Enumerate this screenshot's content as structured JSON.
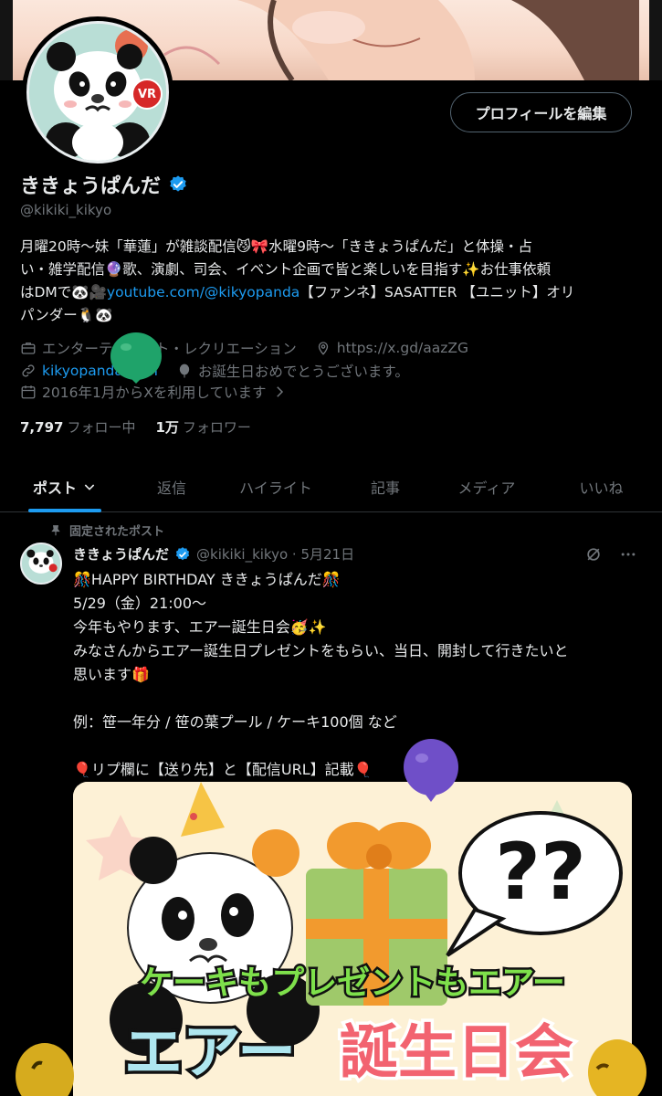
{
  "profile": {
    "display_name": "ききょうぱんだ",
    "handle": "@kikiki_kikyo",
    "edit_button": "プロフィールを編集",
    "avatar_badge": "VR",
    "bio": {
      "line1": "月曜20時〜妹「華蓮」が雑談配信😼🎀水曜9時〜「ききょうぱんだ」と体操・占",
      "line2": "い・雑学配信🔮歌、演劇、司会、イベント企画で皆と楽しいを目指す✨お仕事依頼",
      "line3_pre": "はDMで🐼🎥",
      "line3_link": "youtube.com/@kikyopanda",
      "line3_post": "【ファンネ】SASATTER 【ユニット】オリ",
      "line4": "パンダー🐧🐼"
    },
    "category": "エンターテイメント・レクリエーション",
    "location_link": "https://x.gd/aazZG",
    "website": "kikyopanda.com",
    "birthday": "お誕生日おめでとうございます。",
    "joined": "2016年1月からXを利用しています",
    "following_count": "7,797",
    "following_label": "フォロー中",
    "followers_count": "1万",
    "followers_label": "フォロワー"
  },
  "tabs": [
    {
      "label": "ポスト"
    },
    {
      "label": "返信"
    },
    {
      "label": "ハイライト"
    },
    {
      "label": "記事"
    },
    {
      "label": "メディア"
    },
    {
      "label": "いいね"
    }
  ],
  "post": {
    "pinned_label": "固定されたポスト",
    "author": "ききょうぱんだ",
    "handle_date": "@kikiki_kikyo · 5月21日",
    "lines": [
      "🎊HAPPY BIRTHDAY ききょうぱんだ🎊",
      "5/29（金）21:00〜",
      "今年もやります、エアー誕生日会🥳✨",
      "みなさんからエアー誕生日プレゼントをもらい、当日、開封して行きたいと",
      "思います🎁",
      "",
      "例：笹一年分 / 笹の葉プール / ケーキ100個 など",
      "",
      "🎈リプ欄に【送り先】と【配信URL】記載🎈"
    ],
    "image_text": {
      "speech": "??",
      "banner_top": "ケーキもプレゼントもエアー",
      "banner_left": "エアー",
      "banner_right": "誕生日会"
    }
  },
  "colors": {
    "accent": "#1d9bf0",
    "muted": "#71767b",
    "text": "#e7e9ea",
    "border": "#2f3336"
  }
}
